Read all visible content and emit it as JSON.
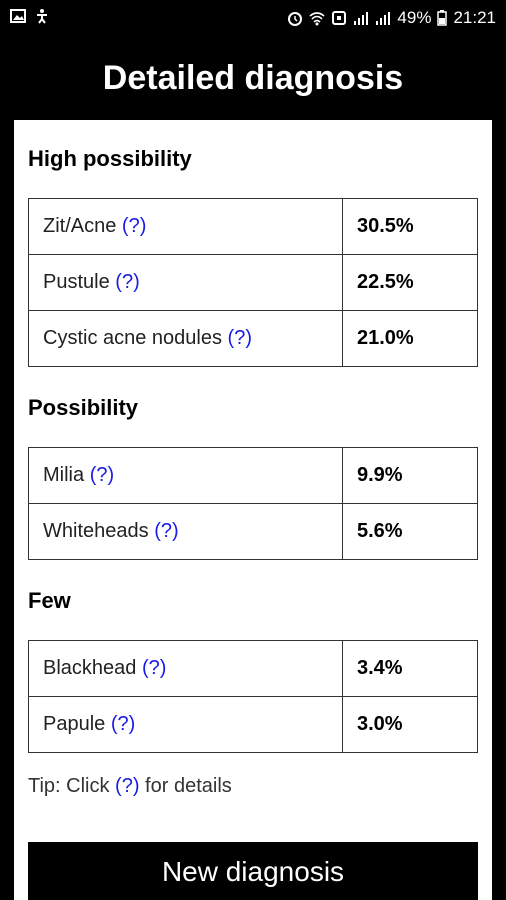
{
  "status_bar": {
    "battery": "49%",
    "time": "21:21"
  },
  "header": {
    "title": "Detailed diagnosis"
  },
  "sections": [
    {
      "title": "High possibility",
      "rows": [
        {
          "name": "Zit/Acne",
          "help": "(?)",
          "value": "30.5%"
        },
        {
          "name": "Pustule",
          "help": "(?)",
          "value": "22.5%"
        },
        {
          "name": "Cystic acne nodules",
          "help": "(?)",
          "value": "21.0%"
        }
      ]
    },
    {
      "title": "Possibility",
      "rows": [
        {
          "name": "Milia",
          "help": "(?)",
          "value": "9.9%"
        },
        {
          "name": "Whiteheads",
          "help": "(?)",
          "value": "5.6%"
        }
      ]
    },
    {
      "title": "Few",
      "rows": [
        {
          "name": "Blackhead",
          "help": "(?)",
          "value": "3.4%"
        },
        {
          "name": "Papule",
          "help": "(?)",
          "value": "3.0%"
        }
      ]
    }
  ],
  "tip": {
    "prefix": "Tip: Click ",
    "help": "(?)",
    "suffix": " for details"
  },
  "button": {
    "new_diagnosis": "New diagnosis"
  },
  "colors": {
    "link": "#1a1ae6",
    "header_bg": "#000000"
  }
}
